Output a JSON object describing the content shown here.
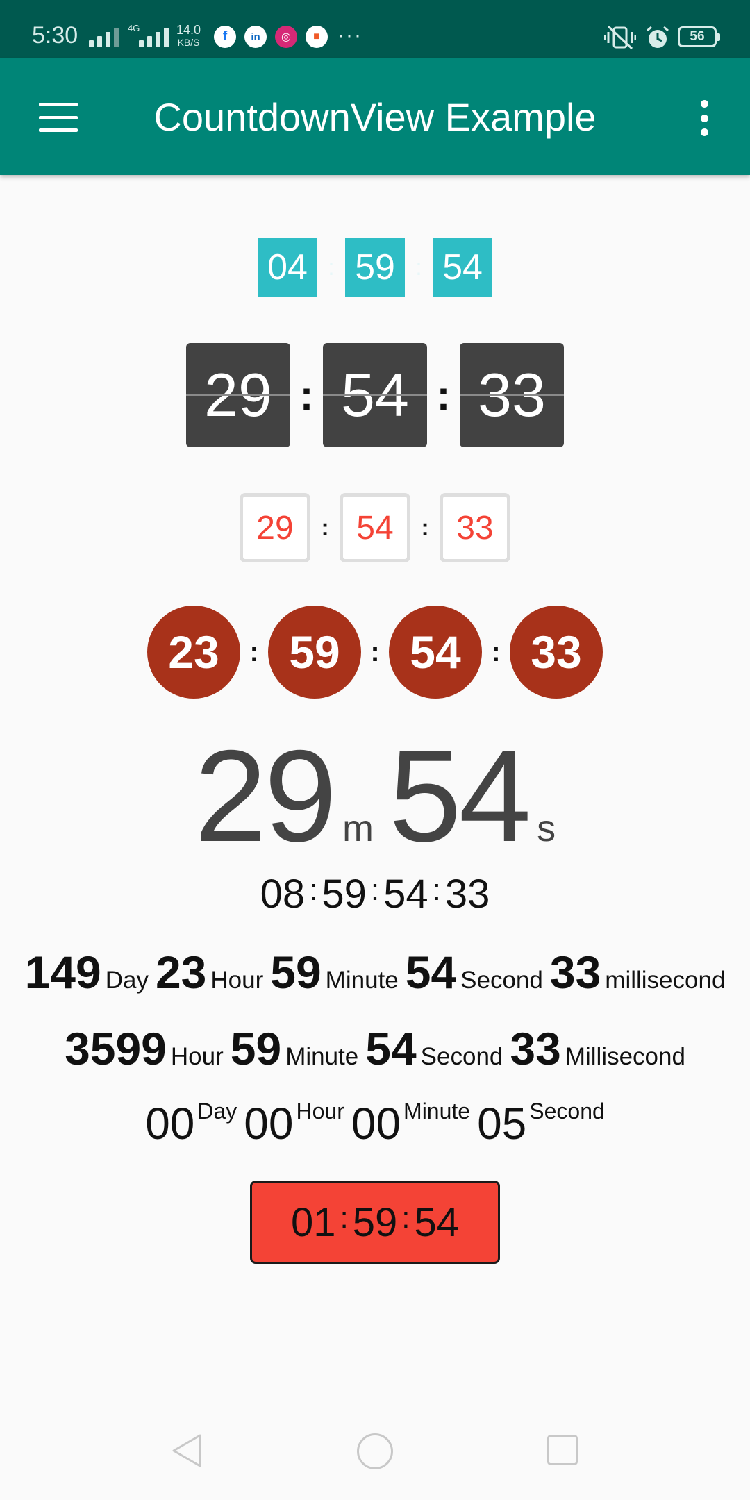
{
  "status_bar": {
    "time": "5:30",
    "network_type": "4G",
    "speed_value": "14.0",
    "speed_unit": "KB/S",
    "notifications_more": "···",
    "battery": "56"
  },
  "app_bar": {
    "title": "CountdownView Example"
  },
  "countdowns": {
    "cyan": [
      "04",
      "59",
      "54"
    ],
    "dark": [
      "29",
      "54",
      "33"
    ],
    "outline": [
      "29",
      "54",
      "33"
    ],
    "circles": [
      "23",
      "59",
      "54",
      "33"
    ],
    "big": {
      "minutes": "29",
      "minutes_suffix": "m",
      "seconds": "54",
      "seconds_suffix": "s"
    },
    "plain": [
      "08",
      "59",
      "54",
      "33"
    ],
    "day_row": [
      {
        "value": "149",
        "unit": "Day"
      },
      {
        "value": "23",
        "unit": "Hour"
      },
      {
        "value": "59",
        "unit": "Minute"
      },
      {
        "value": "54",
        "unit": "Second"
      },
      {
        "value": "33",
        "unit": "millisecond"
      }
    ],
    "hour_row": [
      {
        "value": "3599",
        "unit": "Hour"
      },
      {
        "value": "59",
        "unit": "Minute"
      },
      {
        "value": "54",
        "unit": "Second"
      },
      {
        "value": "33",
        "unit": "Millisecond"
      }
    ],
    "superscript_row": [
      {
        "value": "00",
        "unit": "Day"
      },
      {
        "value": "00",
        "unit": "Hour"
      },
      {
        "value": "00",
        "unit": "Minute"
      },
      {
        "value": "05",
        "unit": "Second"
      }
    ],
    "button": [
      "01",
      "59",
      "54"
    ]
  },
  "separator": ":",
  "colors": {
    "status_bar": "#00594f",
    "app_bar": "#008577",
    "cyan_box": "#2ebdc5",
    "dark_box": "#424242",
    "outline_text": "#f44336",
    "circle": "#a8321a",
    "button": "#f44336"
  }
}
